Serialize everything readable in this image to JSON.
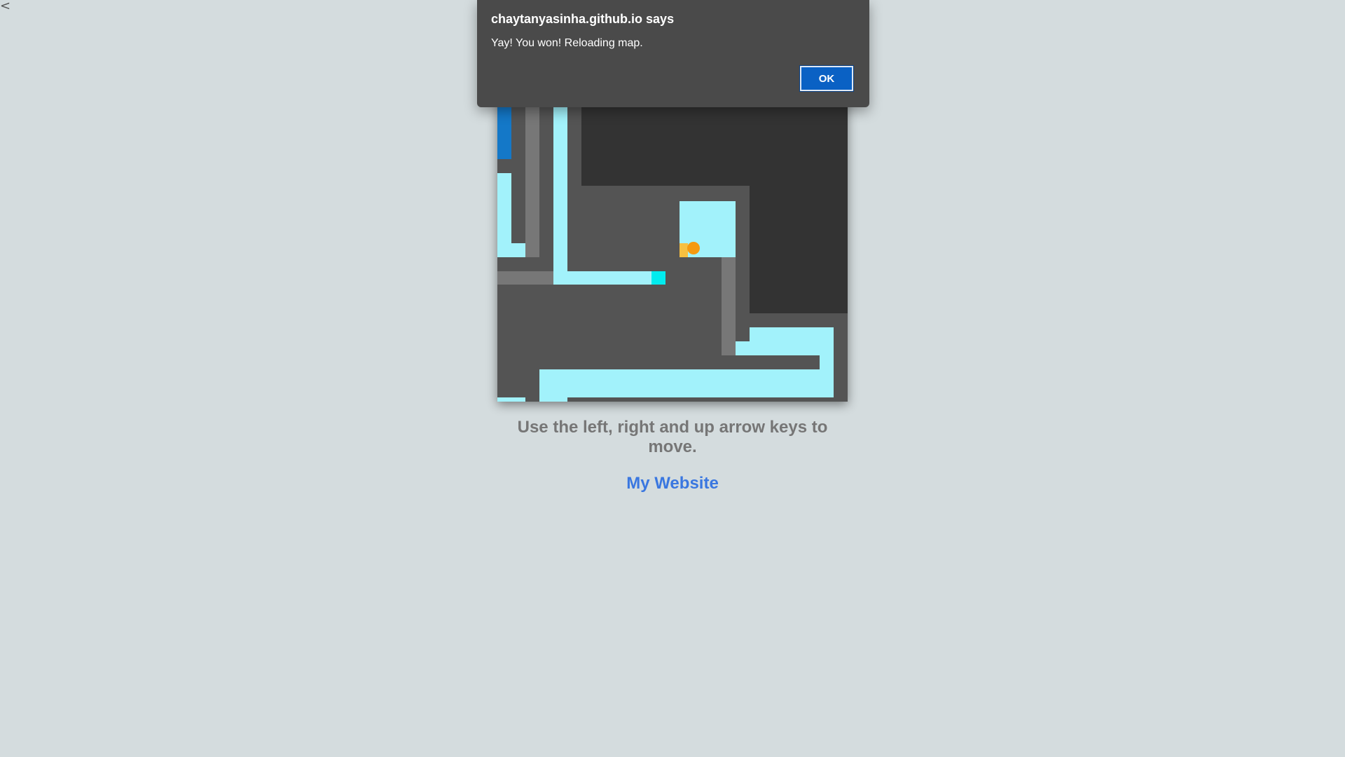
{
  "page": {
    "back_glyph": "<",
    "instructions": "Use the left, right and up arrow keys to move.",
    "link_label": "My Website"
  },
  "dialog": {
    "title": "chaytanyasinha.github.io says",
    "message": "Yay! You won! Reloading map.",
    "ok_label": "OK"
  },
  "game": {
    "colors": {
      "background": "#545454",
      "dark_zone": "#333333",
      "wall": "#777777",
      "path": "#a2f2fb",
      "goal": "#00ecef",
      "start": "#1478c8",
      "player": "#f59a10",
      "player_trail": "#f7c040"
    }
  }
}
